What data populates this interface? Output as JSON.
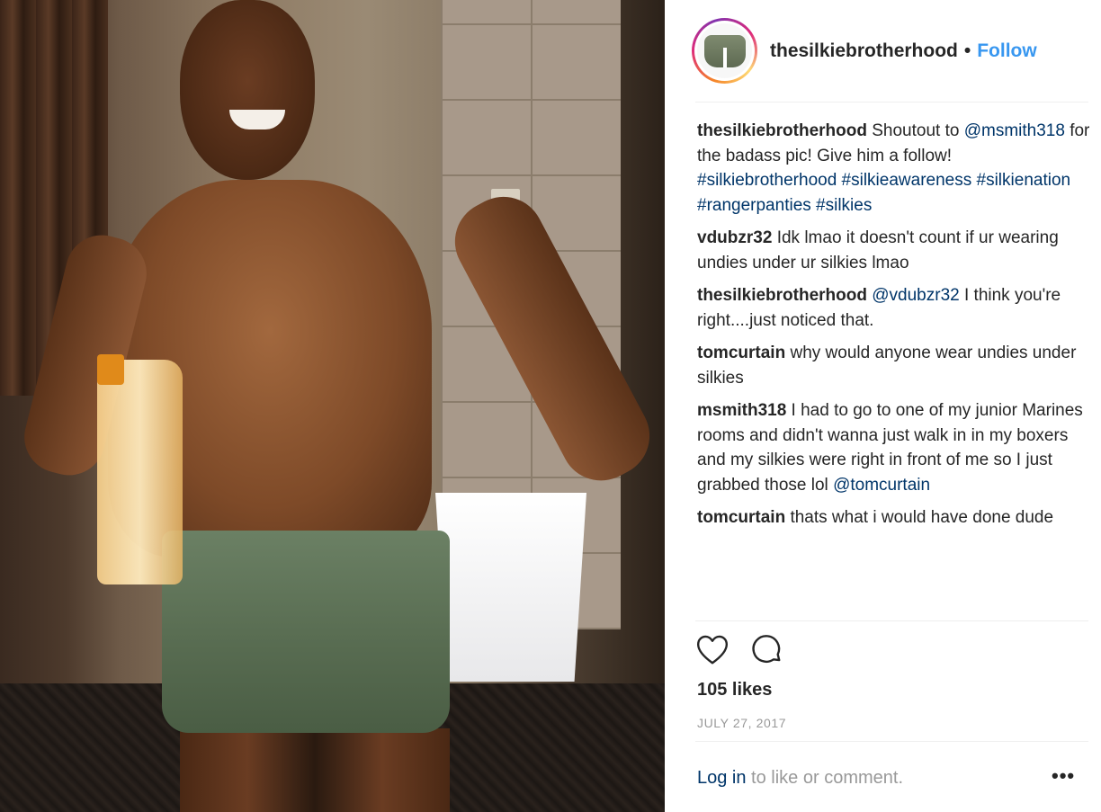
{
  "post": {
    "username": "thesilkiebrotherhood",
    "separator": "•",
    "follow_label": "Follow"
  },
  "comments": [
    {
      "user": "thesilkiebrotherhood",
      "parts": [
        {
          "t": " Shoutout to "
        },
        {
          "t": "@msmith318",
          "link": true
        },
        {
          "t": " for the badass pic! Give him a follow! "
        },
        {
          "t": "#silkiebrotherhood",
          "link": true
        },
        {
          "t": " "
        },
        {
          "t": "#silkieawareness",
          "link": true
        },
        {
          "t": " "
        },
        {
          "t": "#silkienation",
          "link": true
        },
        {
          "t": " "
        },
        {
          "t": "#rangerpanties",
          "link": true
        },
        {
          "t": " "
        },
        {
          "t": "#silkies",
          "link": true
        }
      ]
    },
    {
      "user": "vdubzr32",
      "parts": [
        {
          "t": " Idk lmao it doesn't count if ur wearing undies under ur silkies lmao"
        }
      ]
    },
    {
      "user": "thesilkiebrotherhood",
      "parts": [
        {
          "t": " "
        },
        {
          "t": "@vdubzr32",
          "link": true
        },
        {
          "t": " I think you're right....just noticed that."
        }
      ]
    },
    {
      "user": "tomcurtain",
      "parts": [
        {
          "t": " why would anyone wear undies under silkies"
        }
      ]
    },
    {
      "user": "msmith318",
      "parts": [
        {
          "t": " I had to go to one of my junior Marines rooms and didn't wanna just walk in in my boxers and my silkies were right in front of me so I just grabbed those lol "
        },
        {
          "t": "@tomcurtain",
          "link": true
        }
      ]
    },
    {
      "user": "tomcurtain",
      "parts": [
        {
          "t": " thats what i would have done dude"
        }
      ]
    }
  ],
  "actions": {
    "like_icon": "heart-icon",
    "comment_icon": "comment-icon",
    "likes_text": "105 likes",
    "date_text": "JULY 27, 2017"
  },
  "footer": {
    "login_label": "Log in",
    "rest_text": " to like or comment.",
    "more_label": "•••"
  },
  "colors": {
    "link": "#003569",
    "follow": "#3897f0",
    "muted": "#999999",
    "text": "#262626"
  }
}
